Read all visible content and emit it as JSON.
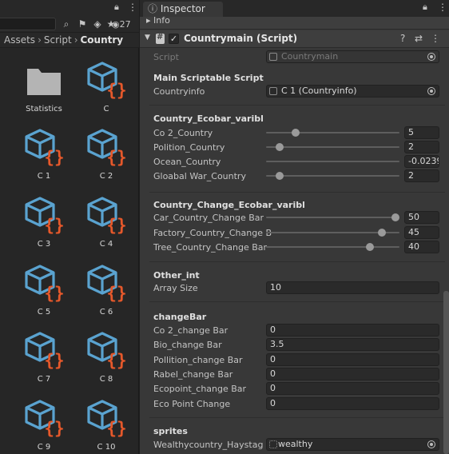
{
  "project": {
    "eye_count": "27",
    "breadcrumb": {
      "assets": "Assets",
      "script": "Script",
      "current": "Country"
    },
    "assets": [
      {
        "label": "Statistics",
        "icon": "folder-icon"
      },
      {
        "label": "C",
        "icon": "scriptable-object-icon"
      },
      {
        "label": "C 1",
        "icon": "scriptable-object-icon"
      },
      {
        "label": "C 2",
        "icon": "scriptable-object-icon"
      },
      {
        "label": "C 3",
        "icon": "scriptable-object-icon"
      },
      {
        "label": "C 4",
        "icon": "scriptable-object-icon"
      },
      {
        "label": "C 5",
        "icon": "scriptable-object-icon"
      },
      {
        "label": "C 6",
        "icon": "scriptable-object-icon"
      },
      {
        "label": "C 7",
        "icon": "scriptable-object-icon"
      },
      {
        "label": "C 8",
        "icon": "scriptable-object-icon"
      },
      {
        "label": "C 9",
        "icon": "scriptable-object-icon"
      },
      {
        "label": "C 10",
        "icon": "scriptable-object-icon"
      }
    ]
  },
  "inspector": {
    "tab_label": "Inspector",
    "info_label": "Info",
    "component_title": "Countrymain (Script)",
    "script_label": "Script",
    "script_value": "Countrymain",
    "main_header": "Main Scriptable Script",
    "countryinfo_label": "Countryinfo",
    "countryinfo_value": "C 1 (Countryinfo)",
    "ecobar_header": "Country_Ecobar_varibl",
    "ecobar": [
      {
        "label": "Co 2_Country",
        "value": "5",
        "fraction": 0.22
      },
      {
        "label": "Polition_Country",
        "value": "2",
        "fraction": 0.1
      },
      {
        "label": "Ocean_Country",
        "value": "-0.0239",
        "fraction": 1.0
      },
      {
        "label": "Gloabal War_Country",
        "value": "2",
        "fraction": 0.1
      }
    ],
    "change_header": "Country_Change_Ecobar_varibl",
    "change": [
      {
        "label": "Car_Country_Change Bar",
        "value": "50",
        "fraction": 0.97
      },
      {
        "label": "Factory_Country_Change B",
        "value": "45",
        "fraction": 0.87
      },
      {
        "label": "Tree_Country_Change Bar",
        "value": "40",
        "fraction": 0.78
      }
    ],
    "other_header": "Other_int",
    "array_size_label": "Array Size",
    "array_size_value": "10",
    "changebar_header": "changeBar",
    "changebar": [
      {
        "label": "Co 2_change Bar",
        "value": "0"
      },
      {
        "label": "Bio_change Bar",
        "value": "3.5"
      },
      {
        "label": "Pollition_change Bar",
        "value": "0"
      },
      {
        "label": "Rabel_change Bar",
        "value": "0"
      },
      {
        "label": "Ecopoint_change Bar",
        "value": "0"
      },
      {
        "label": "Eco Point Change",
        "value": "0"
      }
    ],
    "sprites_header": "sprites",
    "wealthy_label": "Wealthycountry_Haystag Ic",
    "wealthy_value": "wealthy"
  },
  "colors": {
    "cube": "#5aa3d0",
    "braces": "#e5582b",
    "folder": "#b4b4b4"
  }
}
